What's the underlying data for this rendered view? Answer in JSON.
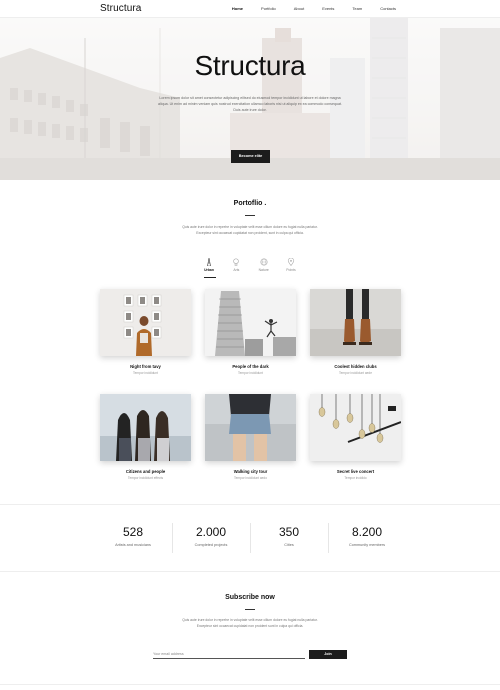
{
  "brand": {
    "logo": "Structura"
  },
  "nav": {
    "items": [
      {
        "label": "Home",
        "active": true
      },
      {
        "label": "Portfolio",
        "active": false
      },
      {
        "label": "About",
        "active": false
      },
      {
        "label": "Events",
        "active": false
      },
      {
        "label": "Team",
        "active": false
      },
      {
        "label": "Contacts",
        "active": false
      }
    ]
  },
  "hero": {
    "title": "Structura",
    "text": "Lorem ipsum dolor sit amet consectetur adipiscing eiltsed do eiusmod tempor incididunt ut labore et dolore magna aliqua. Ut enim ad minim veniam quis nostrud exercitation ullamco laboris nisi ut aliquip ex ea commodo consequat. Duis aute irure dolor.",
    "button": "Become elite"
  },
  "portfolio": {
    "title": "Portoflio .",
    "text": "Quis aute irure dolor in reprehe in voluptate velit esse cillum dolore eu fugiat nulla pariatur. Excepteur sint occaecat cupidatat non proident, sunt in culpa qui officia.",
    "filters": [
      {
        "label": "Urban",
        "icon": "tower-icon",
        "active": true
      },
      {
        "label": "Arts",
        "icon": "bulb-icon",
        "active": false
      },
      {
        "label": "Nature",
        "icon": "globe-icon",
        "active": false
      },
      {
        "label": "Points",
        "icon": "pin-icon",
        "active": false
      }
    ],
    "cards": [
      {
        "title": "Night from tavy",
        "subtitle": "Tempor incididunt"
      },
      {
        "title": "People of the dark",
        "subtitle": "Tempor incididunt"
      },
      {
        "title": "Coolest hidden clubs",
        "subtitle": "Tempor incididunt aede"
      },
      {
        "title": "Citizens and people",
        "subtitle": "Tempor incididunt effects"
      },
      {
        "title": "Walking city tour",
        "subtitle": "Tempor incididunt aedo"
      },
      {
        "title": "Secret live concert",
        "subtitle": "Tempor incidido"
      }
    ]
  },
  "stats": [
    {
      "value": "528",
      "label": "Artists and musicians"
    },
    {
      "value": "2.000",
      "label": "Completed projects"
    },
    {
      "value": "350",
      "label": "Cities"
    },
    {
      "value": "8.200",
      "label": "Community members"
    }
  ],
  "subscribe": {
    "title": "Subscribe now",
    "text": "Quis aute irure dolor in reprehe in voluptate velit esse cillum dolore eu fugiat nulla pariatur. Excepteur sint occaecat cupidatat non proident sunt in culpa qui officia.",
    "placeholder": "Your email address",
    "button": "Join"
  }
}
